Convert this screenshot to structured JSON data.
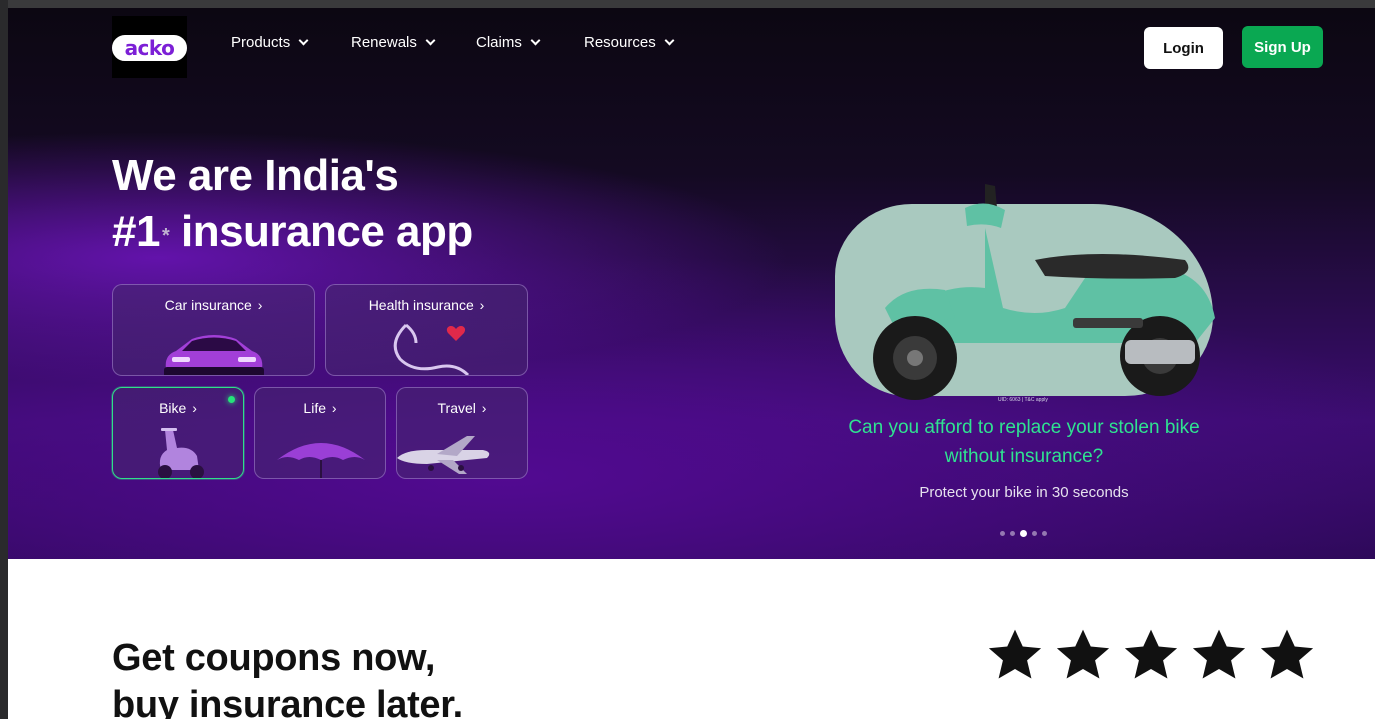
{
  "nav": {
    "logo_text": "acko",
    "items": [
      {
        "label": "Products"
      },
      {
        "label": "Renewals"
      },
      {
        "label": "Claims"
      },
      {
        "label": "Resources"
      }
    ],
    "login_label": "Login",
    "signup_label": "Sign Up"
  },
  "hero": {
    "headline_line1": "We are India's",
    "headline_line2_prefix": "#1",
    "headline_sup": "*",
    "headline_line2_suffix": " insurance app",
    "cards": [
      {
        "label": "Car insurance",
        "arrow": "›"
      },
      {
        "label": "Health insurance",
        "arrow": "›"
      },
      {
        "label": "Bike",
        "arrow": "›"
      },
      {
        "label": "Life",
        "arrow": "›"
      },
      {
        "label": "Travel",
        "arrow": "›"
      }
    ],
    "promo": {
      "fine_print": "UID: 6063 | T&C apply",
      "title": "Can you afford to replace your stolen bike without insurance?",
      "subtitle": "Protect your bike in 30 seconds",
      "carousel_active_index": 2,
      "carousel_count": 5
    }
  },
  "lower": {
    "title_line1": "Get coupons now,",
    "title_line2": "buy insurance later.",
    "rating_stars": 5
  },
  "colors": {
    "brand_purple": "#7c1fd6",
    "signup_green": "#0aa852",
    "promo_green": "#2fe391",
    "scooter_teal": "#5fc1a4"
  }
}
